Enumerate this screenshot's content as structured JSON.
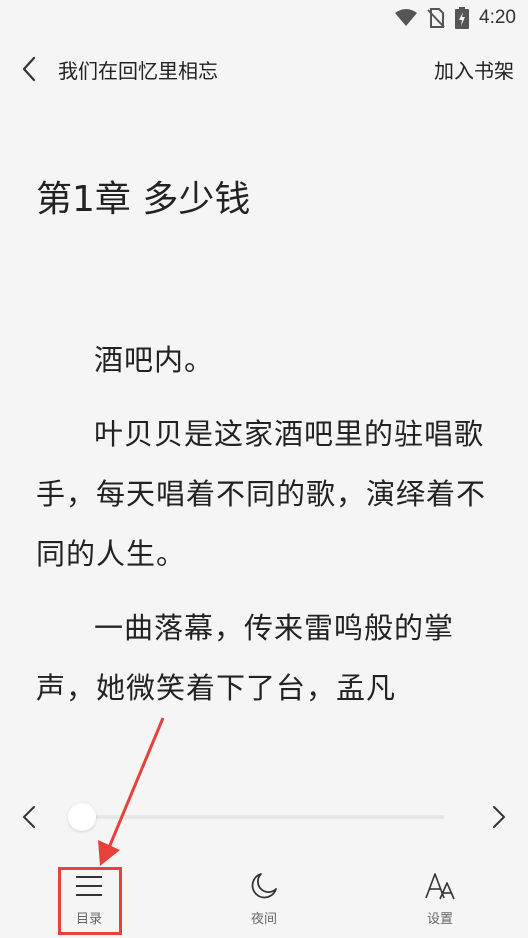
{
  "status_bar": {
    "time": "4:20"
  },
  "header": {
    "title": "我们在回忆里相忘",
    "add_to_shelf": "加入书架"
  },
  "chapter": {
    "title": "第1章 多少钱",
    "paragraphs": [
      "酒吧内。",
      "叶贝贝是这家酒吧里的驻唱歌手，每天唱着不同的歌，演绎着不同的人生。",
      "一曲落幕，传来雷鸣般的掌声，她微笑着下了台，孟凡"
    ]
  },
  "progress": {
    "value": 0.0
  },
  "bottom_bar": {
    "toc_label": "目录",
    "night_label": "夜间",
    "settings_label": "设置"
  },
  "colors": {
    "background": "#f5f5f5",
    "text": "#222222",
    "annotation": "#e8413c"
  },
  "icons": [
    "wifi-icon",
    "no-sim-icon",
    "battery-charging-icon",
    "back-chevron-icon",
    "prev-chevron-icon",
    "next-chevron-icon",
    "menu-icon",
    "moon-icon",
    "font-icon"
  ]
}
